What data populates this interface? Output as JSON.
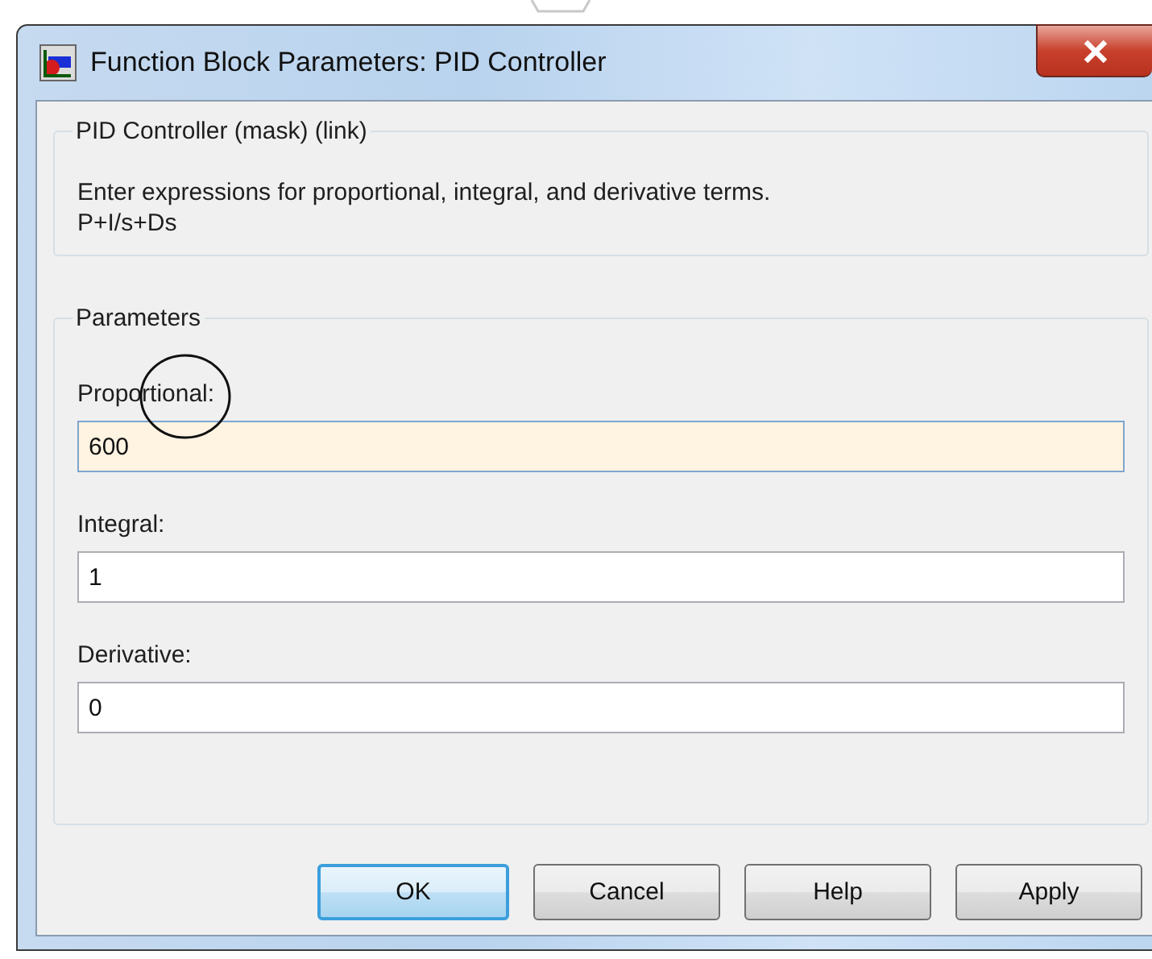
{
  "window": {
    "title": "Function Block Parameters: PID Controller"
  },
  "description_group": {
    "legend": "PID Controller (mask) (link)",
    "lines": [
      "Enter expressions for proportional, integral, and derivative terms.",
      "P+I/s+Ds"
    ]
  },
  "parameters_group": {
    "legend": "Parameters",
    "fields": [
      {
        "label": "Proportional:",
        "value": "600",
        "focused": true
      },
      {
        "label": "Integral:",
        "value": "1",
        "focused": false
      },
      {
        "label": "Derivative:",
        "value": "0",
        "focused": false
      }
    ]
  },
  "buttons": [
    {
      "label": "OK",
      "default": true
    },
    {
      "label": "Cancel",
      "default": false
    },
    {
      "label": "Help",
      "default": false
    },
    {
      "label": "Apply",
      "default": false
    }
  ]
}
